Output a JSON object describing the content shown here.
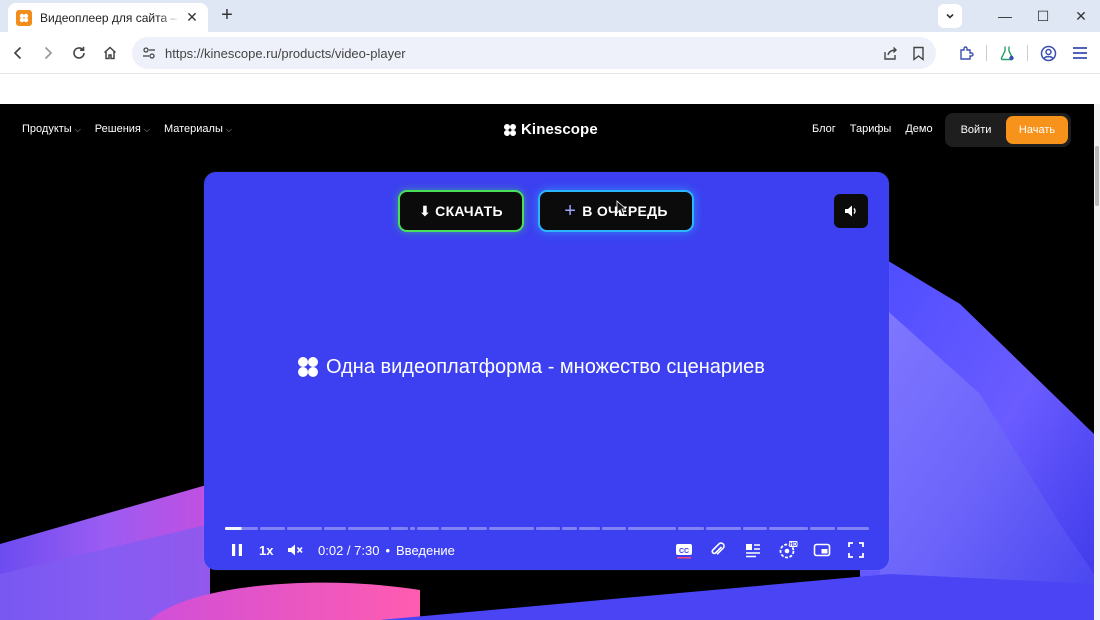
{
  "browser": {
    "tab_title": "Видеоплеер для сайта – готовое решение",
    "tab_close": "✕",
    "new_tab": "+",
    "url": "https://kinescope.ru/products/video-player",
    "window_controls": {
      "minimize": "—",
      "maximize": "☐",
      "close": "✕"
    }
  },
  "site_nav": {
    "menu": [
      {
        "label": "Продукты"
      },
      {
        "label": "Решения"
      },
      {
        "label": "Материалы"
      }
    ],
    "logo": "Kinescope",
    "right_links": [
      {
        "label": "Блог"
      },
      {
        "label": "Тарифы"
      },
      {
        "label": "Демо"
      }
    ],
    "login": "Войти",
    "start": "Начать"
  },
  "player": {
    "download_label": "СКАЧАТЬ",
    "download_arrow": "⬇",
    "queue_plus": "+",
    "queue_label": "В ОЧЕРЕДЬ",
    "headline": "Одна видеоплатформа - множество сценариев",
    "speed": "1x",
    "time": "0:02 / 7:30",
    "separator": "•",
    "chapter": "Введение",
    "progress_fraction": 0.004
  },
  "colors": {
    "player_bg": "#3c40f0",
    "accent_orange": "#f7931a",
    "download_border": "#48e05a",
    "queue_border": "#2bb6ff"
  }
}
